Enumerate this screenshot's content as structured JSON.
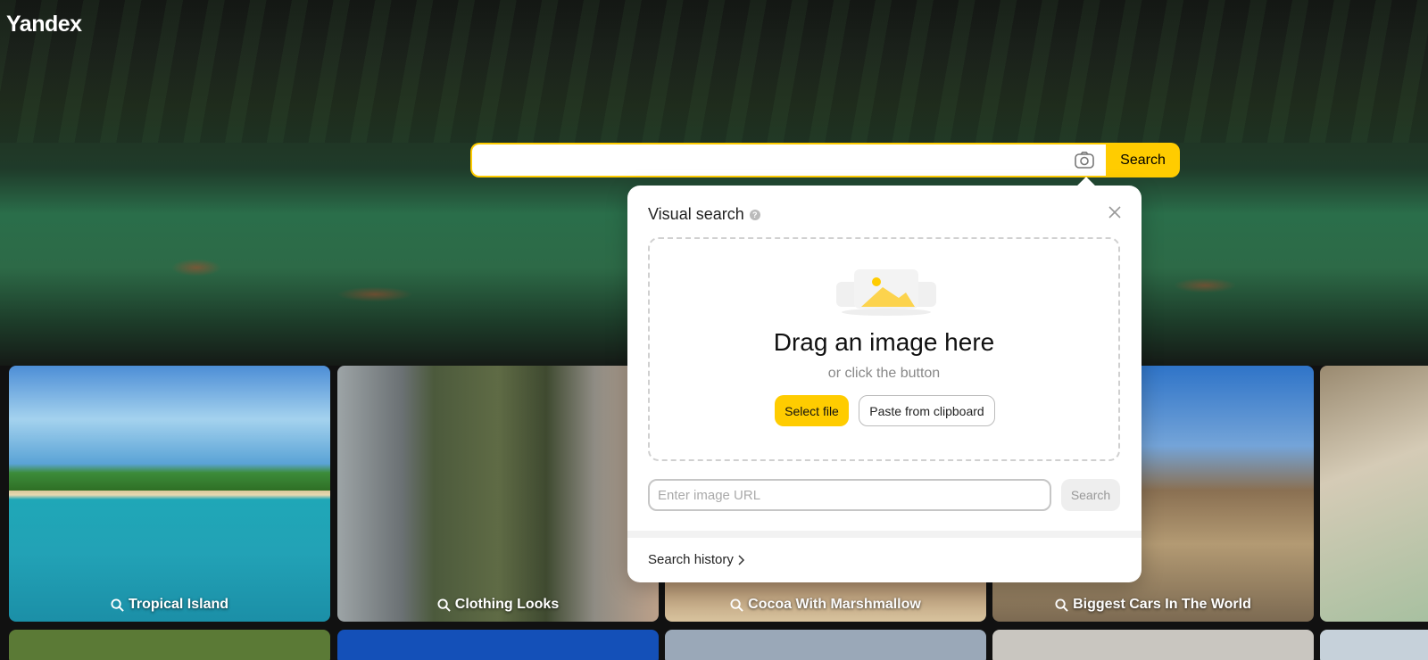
{
  "brand": {
    "logo_text": "Yandex"
  },
  "search": {
    "button_label": "Search",
    "value": "",
    "camera_icon": "camera-lens-icon"
  },
  "visual_search": {
    "title": "Visual search",
    "help_icon": "?",
    "dropzone": {
      "title": "Drag an image here",
      "subtitle": "or click the button",
      "select_file_label": "Select file",
      "paste_label": "Paste from clipboard"
    },
    "url_placeholder": "Enter image URL",
    "url_search_label": "Search",
    "history_label": "Search history"
  },
  "tiles": [
    {
      "label": "Tropical Island"
    },
    {
      "label": "Clothing Looks"
    },
    {
      "label": "Cocoa With Marshmallow"
    },
    {
      "label": "Biggest Cars In The World"
    }
  ],
  "colors": {
    "accent": "#ffcc00"
  }
}
